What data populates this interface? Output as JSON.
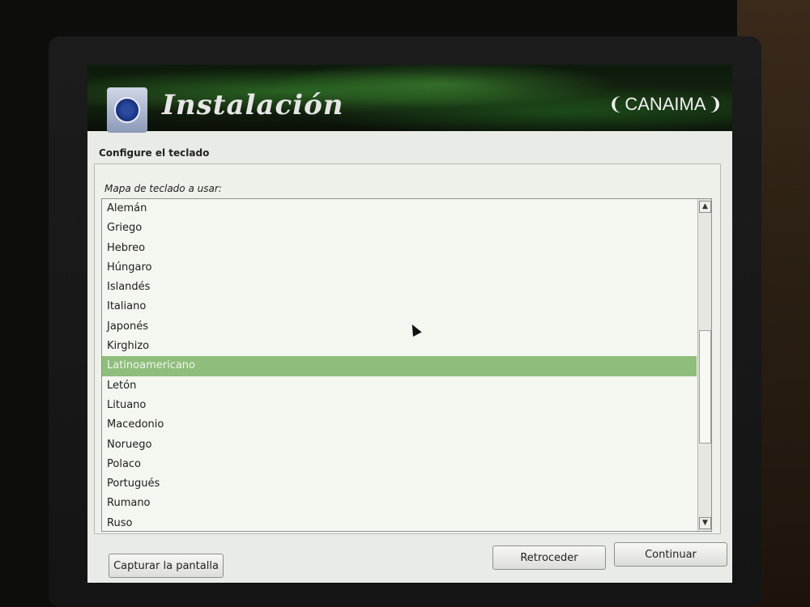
{
  "window": {
    "title": "Instalación",
    "brand": "CANAIMA"
  },
  "page": {
    "heading": "Configure el teclado"
  },
  "keyboard_list": {
    "label": "Mapa de teclado a usar:",
    "items": [
      "Alemán",
      "Griego",
      "Hebreo",
      "Húngaro",
      "Islandés",
      "Italiano",
      "Japonés",
      "Kirghizo",
      "Latinoamericano",
      "Letón",
      "Lituano",
      "Macedonio",
      "Noruego",
      "Polaco",
      "Portugués",
      "Rumano",
      "Ruso"
    ],
    "selected": "Latinoamericano"
  },
  "buttons": {
    "screenshot": "Capturar la pantalla",
    "back": "Retroceder",
    "continue": "Continuar"
  },
  "icons": {
    "app": "disc-icon",
    "scroll_up": "chevron-up-icon",
    "scroll_down": "chevron-down-icon",
    "pointer": "mouse-pointer-icon"
  },
  "colors": {
    "selection": "#8fbd7c",
    "background": "#e9ece6"
  }
}
